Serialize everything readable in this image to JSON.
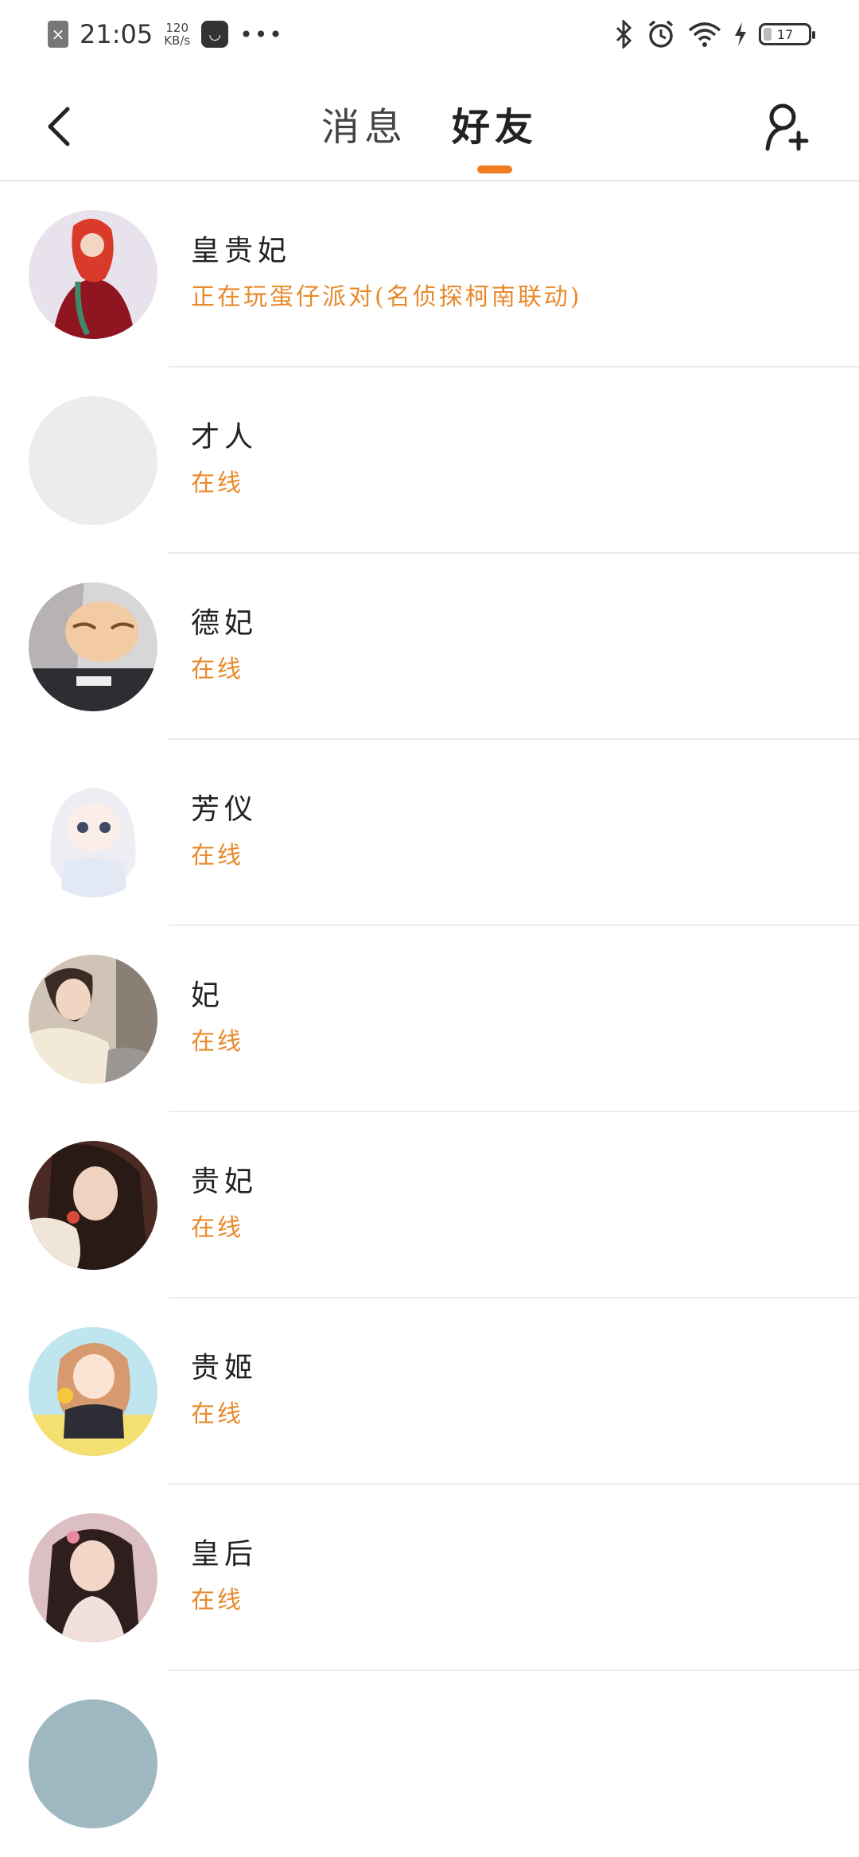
{
  "status_bar": {
    "time": "21:05",
    "speed_value": "120",
    "speed_unit": "KB/s",
    "more": "•••",
    "battery": "17"
  },
  "header": {
    "tabs": [
      {
        "label": "消息",
        "active": false
      },
      {
        "label": "好友",
        "active": true
      }
    ],
    "accent_color": "#f07c22"
  },
  "friends": [
    {
      "name": "皇贵妃",
      "status": "正在玩蛋仔派对(名侦探柯南联动)"
    },
    {
      "name": "才人",
      "status": "在线"
    },
    {
      "name": "德妃",
      "status": "在线"
    },
    {
      "name": "芳仪",
      "status": "在线"
    },
    {
      "name": "妃",
      "status": "在线"
    },
    {
      "name": "贵妃",
      "status": "在线"
    },
    {
      "name": "贵姬",
      "status": "在线"
    },
    {
      "name": "皇后",
      "status": "在线"
    }
  ],
  "status_color": "#e88a2c"
}
